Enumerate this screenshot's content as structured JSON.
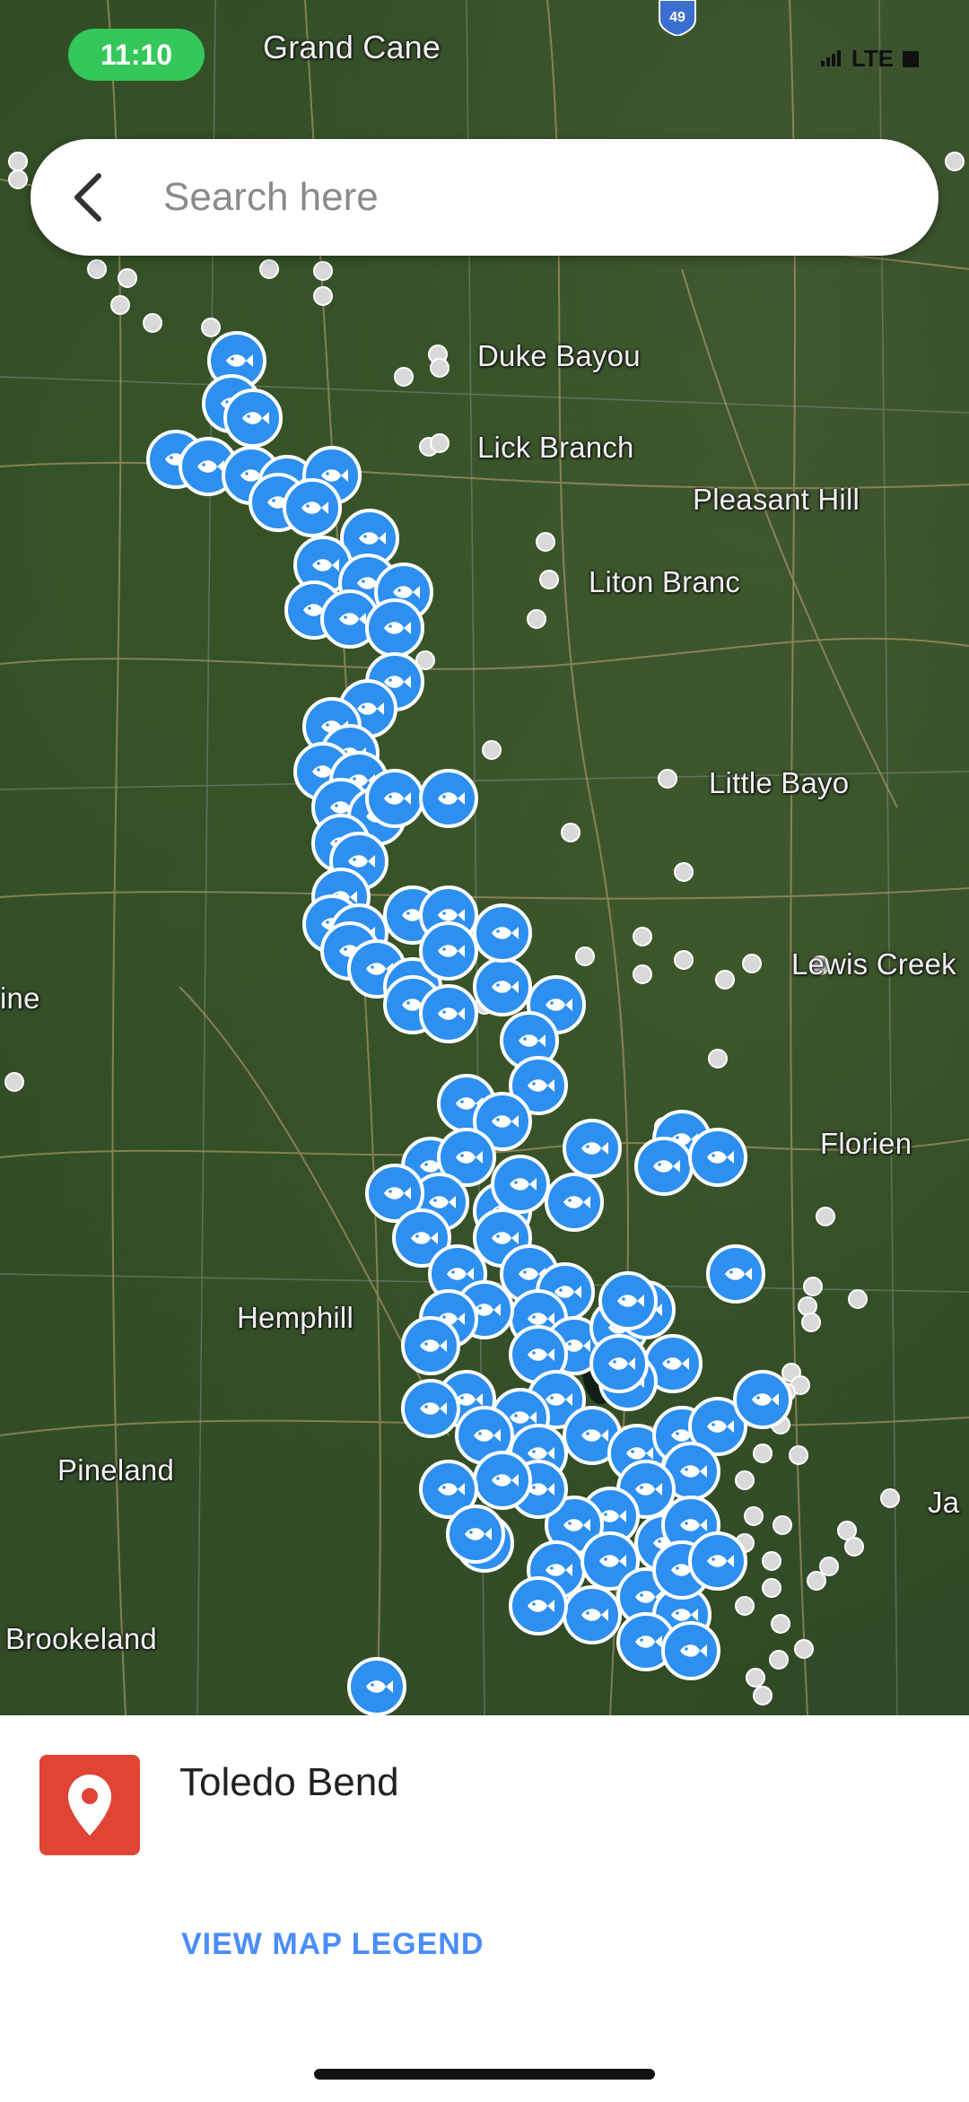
{
  "status_bar": {
    "time": "11:10",
    "network": "LTE"
  },
  "search": {
    "placeholder": "Search here"
  },
  "map": {
    "highway_shield": "49",
    "place_labels": {
      "grand_cane": "Grand Cane",
      "duke_bayou": "Duke Bayou",
      "lick_branch": "Lick Branch",
      "pleasant_hill": "Pleasant Hill",
      "liton_branc": "Liton Branc",
      "little_bayo": "Little Bayo",
      "lewis_creek": "Lewis Creek",
      "ine": "ine",
      "florien": "Florien",
      "hemphill": "Hemphill",
      "pineland": "Pineland",
      "brookeland": "Brookeland",
      "ja": "Ja"
    },
    "marker_color": "#2d8ff0",
    "marker_icon": "fish-icon",
    "minor_point_color": "#d9d9d9"
  },
  "place": {
    "name": "Toledo Bend",
    "icon": "map-pin-icon",
    "icon_color": "#e04434"
  },
  "legend": {
    "label": "VIEW MAP LEGEND"
  }
}
